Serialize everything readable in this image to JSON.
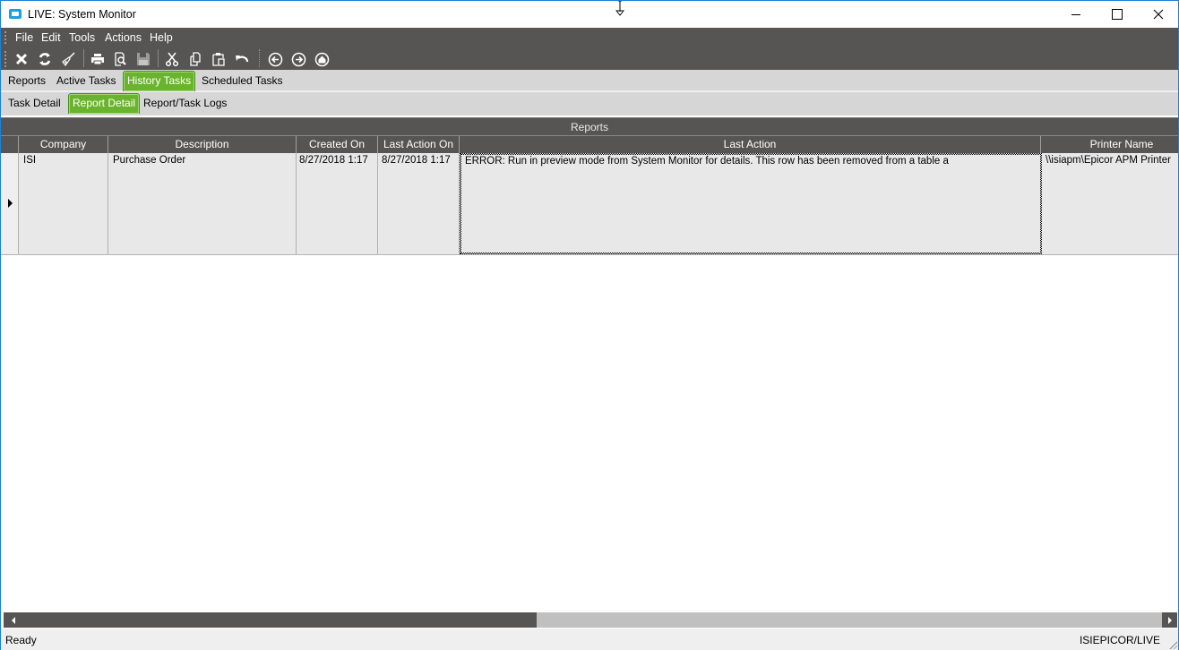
{
  "window": {
    "title": "LIVE: System Monitor",
    "controls": [
      "minimize",
      "maximize",
      "close"
    ]
  },
  "menu": {
    "items": [
      "File",
      "Edit",
      "Tools",
      "Actions",
      "Help"
    ]
  },
  "toolbar": {
    "buttons": [
      {
        "name": "delete",
        "icon": "x-icon"
      },
      {
        "name": "refresh",
        "icon": "refresh-icon"
      },
      {
        "name": "clear",
        "icon": "broom-icon"
      },
      {
        "name": "print",
        "icon": "printer-icon"
      },
      {
        "name": "print-preview",
        "icon": "print-preview-icon"
      },
      {
        "name": "save",
        "icon": "save-icon"
      },
      {
        "name": "cut",
        "icon": "scissors-icon"
      },
      {
        "name": "copy",
        "icon": "copy-icon"
      },
      {
        "name": "paste",
        "icon": "paste-icon"
      },
      {
        "name": "undo",
        "icon": "undo-icon"
      },
      {
        "name": "back",
        "icon": "arrow-left-circle-icon"
      },
      {
        "name": "forward",
        "icon": "arrow-right-circle-icon"
      },
      {
        "name": "home",
        "icon": "home-circle-icon"
      }
    ]
  },
  "tabs": {
    "main": [
      {
        "label": "Reports",
        "active": false
      },
      {
        "label": "Active Tasks",
        "active": false
      },
      {
        "label": "History Tasks",
        "active": true
      },
      {
        "label": "Scheduled Tasks",
        "active": false
      }
    ],
    "sub": [
      {
        "label": "Task Detail",
        "active": false
      },
      {
        "label": "Report Detail",
        "active": true
      },
      {
        "label": "Report/Task Logs",
        "active": false
      }
    ]
  },
  "grid": {
    "caption": "Reports",
    "columns": [
      "Company",
      "Description",
      "Created On",
      "Last Action On",
      "Last Action",
      "Printer Name"
    ],
    "rows": [
      {
        "company": "ISI",
        "description": "Purchase Order",
        "created_on": "8/27/2018 1:17",
        "last_action_on": "8/27/2018 1:17",
        "last_action": "ERROR: Run in preview mode from System Monitor for details. This row has been removed from a table a",
        "printer_name": "\\\\isiapm\\Epicor APM Printer"
      }
    ]
  },
  "statusbar": {
    "status": "Ready",
    "connection": "ISIEPICOR/LIVE"
  },
  "colors": {
    "accent_green": "#6ab42d",
    "toolbar_dark": "#575553",
    "window_border": "#1e7fd6"
  }
}
